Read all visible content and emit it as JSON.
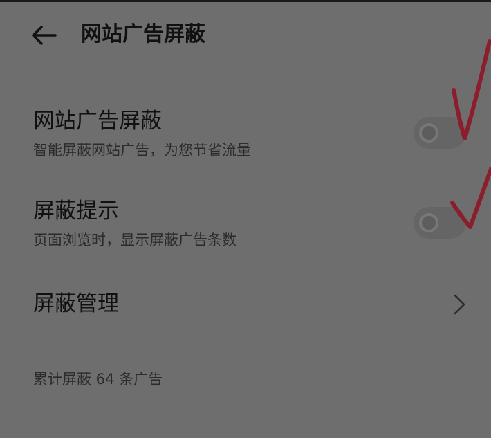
{
  "header": {
    "back_icon": "back-arrow-icon",
    "title": "网站广告屏蔽"
  },
  "settings": {
    "ad_block": {
      "title": "网站广告屏蔽",
      "subtitle": "智能屏蔽网站广告，为您节省流量",
      "enabled": false
    },
    "block_notice": {
      "title": "屏蔽提示",
      "subtitle": "页面浏览时，显示屏蔽广告条数",
      "enabled": false
    },
    "block_management": {
      "title": "屏蔽管理",
      "icon": "chevron-right-icon"
    }
  },
  "footer": {
    "stats": "累计屏蔽 64 条广告"
  },
  "colors": {
    "background": "#6e6e6e",
    "text_primary": "#111111",
    "text_secondary": "#2b2b2b",
    "annotation_mark": "#8b1d2c"
  }
}
